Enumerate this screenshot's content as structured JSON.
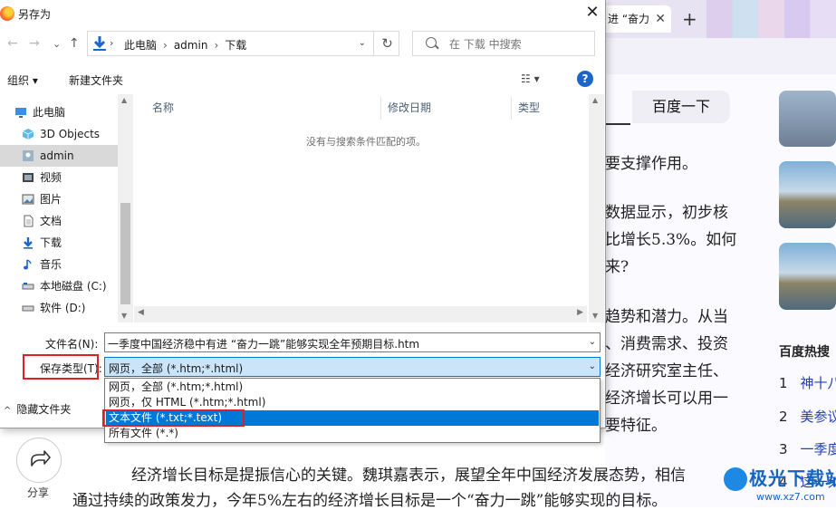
{
  "dialog": {
    "title": "另存为",
    "close": "✕",
    "nav": {
      "back": "←",
      "forward": "→",
      "dropdown": "⌄",
      "up": "↑",
      "refresh": "↻"
    },
    "breadcrumb": [
      "此电脑",
      "admin",
      "下载"
    ],
    "breadcrumb_sep": "›",
    "search_placeholder": "在 下载 中搜索",
    "toolbar": {
      "organize": "组织 ▾",
      "new_folder": "新建文件夹",
      "view": "☷ ▾",
      "help": "?"
    },
    "sidebar": [
      {
        "label": "此电脑",
        "icon": "computer-icon"
      },
      {
        "label": "3D Objects",
        "icon": "cube-icon"
      },
      {
        "label": "admin",
        "icon": "user-folder-icon",
        "selected": true
      },
      {
        "label": "视频",
        "icon": "video-icon"
      },
      {
        "label": "图片",
        "icon": "image-icon"
      },
      {
        "label": "文档",
        "icon": "document-icon"
      },
      {
        "label": "下载",
        "icon": "download-icon"
      },
      {
        "label": "音乐",
        "icon": "music-icon"
      },
      {
        "label": "本地磁盘 (C:)",
        "icon": "drive-icon"
      },
      {
        "label": "软件 (D:)",
        "icon": "drive-icon"
      }
    ],
    "columns": {
      "name": "名称",
      "modified": "修改日期",
      "type": "类型"
    },
    "empty_message": "没有与搜索条件匹配的项。",
    "filename_label": "文件名(N):",
    "filename_value": "一季度中国经济稳中有进 “奋力一跳”能够实现全年预期目标.htm",
    "filetype_label": "保存类型(T):",
    "filetype_value": "网页，全部 (*.htm;*.html)",
    "filetype_options": [
      "网页，全部 (*.htm;*.html)",
      "网页，仅 HTML (*.htm;*.html)",
      "文本文件 (*.txt;*.text)",
      "所有文件 (*.*)"
    ],
    "highlighted_option_index": 2,
    "hide_folders": "隐藏文件夹",
    "accent_color": "#0078d7",
    "annotation_color": "#e02020"
  },
  "browser": {
    "tab_title": "进 “奋力",
    "tab_close": "✕",
    "new_tab": "+",
    "search_button": "百度一下",
    "menu": "⋮",
    "article_right": [
      "要支撑作用。",
      "数据显示，初步核",
      "比增长5.3%。如何",
      "来?",
      "趋势和潜力。从当",
      "、消费需求、投资",
      "经济研究室主任、",
      "经济增长可以用一",
      "要特征。"
    ],
    "article_bottom": [
      "经济增长目标是提振信心的关键。魏琪嘉表示，展望全年中国经济发展态势，相信",
      "通过持续的政策发力，今年5%左右的经济增长目标是一个“奋力一跳”能够实现的目标。"
    ],
    "hot_title": "百度热搜",
    "hot_items": [
      {
        "num": "1",
        "text": "神十八"
      },
      {
        "num": "2",
        "text": "美参议"
      },
      {
        "num": "3",
        "text": "一季度"
      },
      {
        "num": "4",
        "text": "这一刻"
      }
    ],
    "share_label": "分享",
    "watermark": "极光下载站",
    "watermark_sub": "www.xz7.com"
  }
}
